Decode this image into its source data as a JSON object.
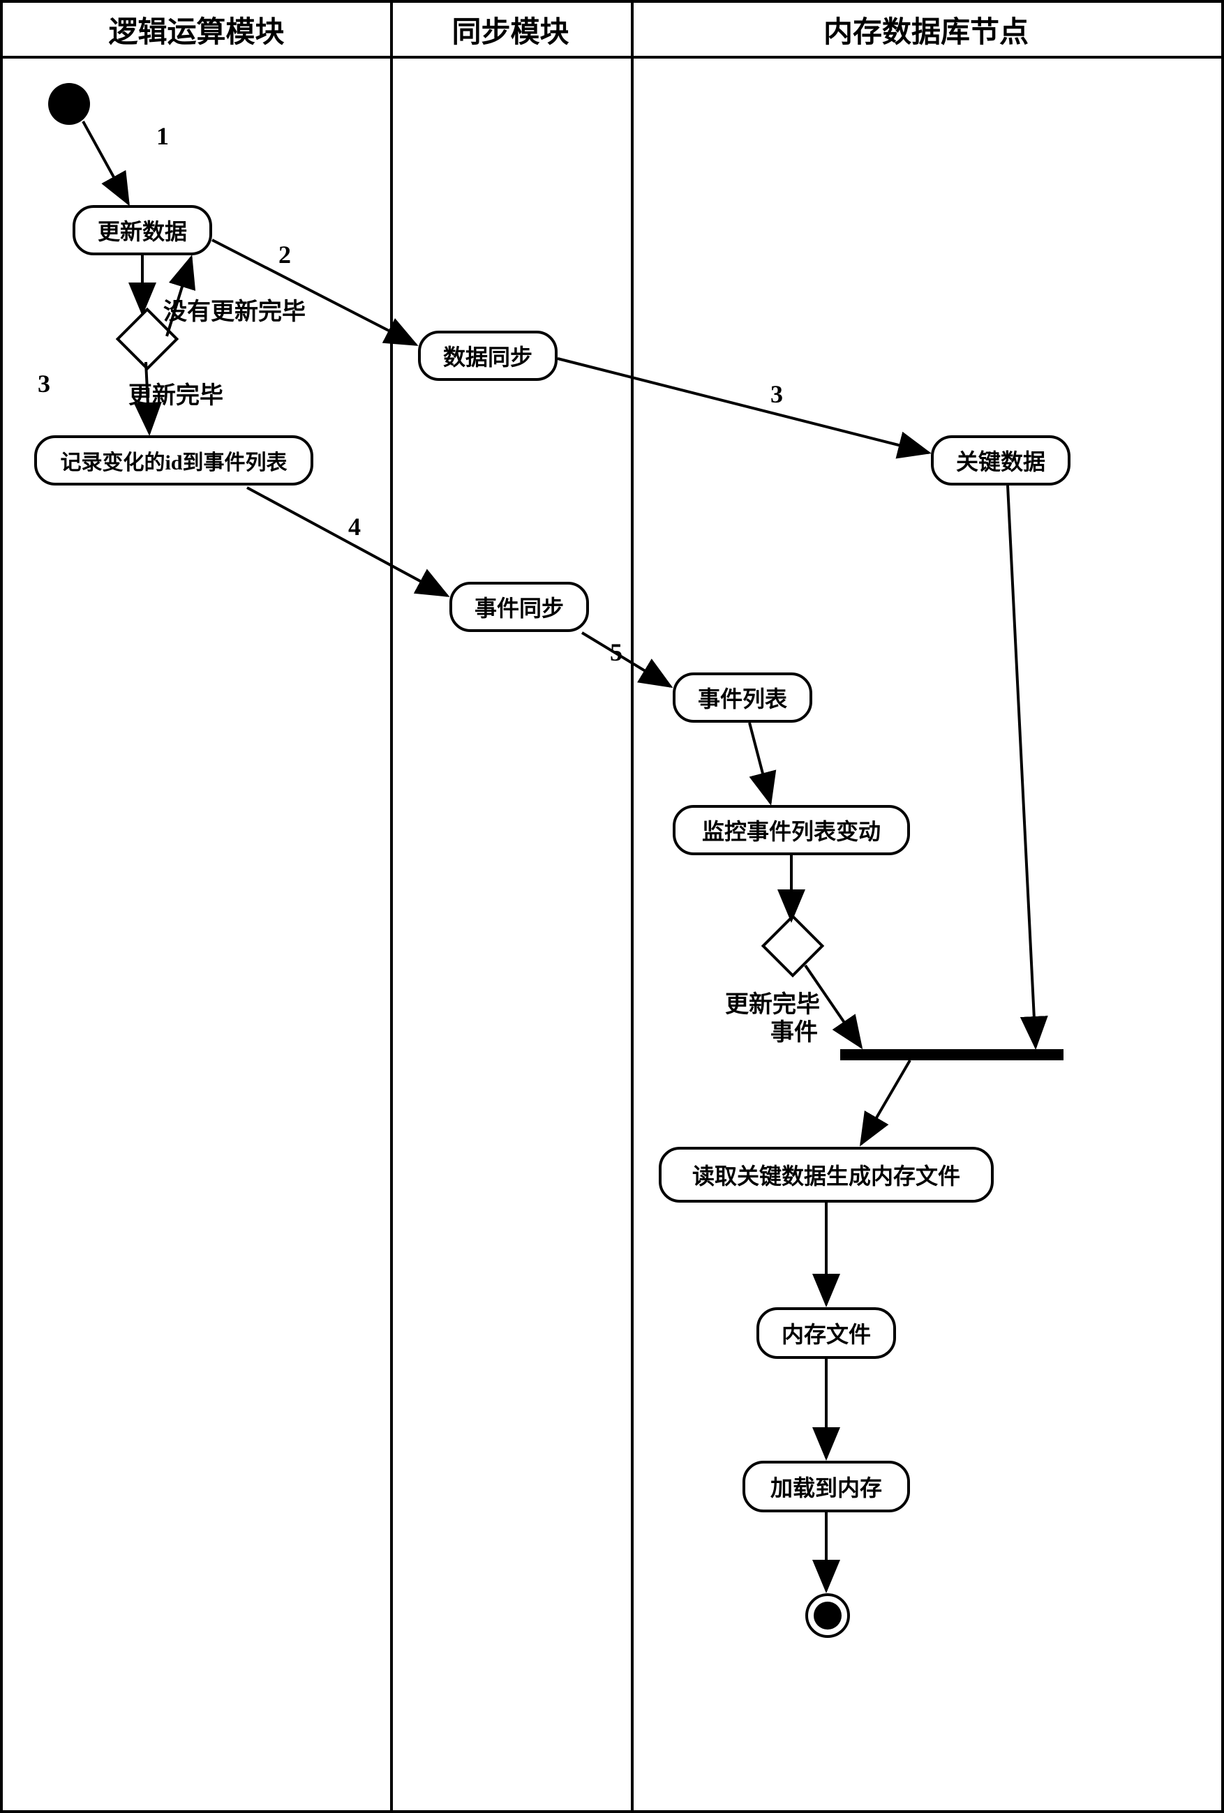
{
  "lanes": {
    "logic": "逻辑运算模块",
    "sync": "同步模块",
    "memdb": "内存数据库节点"
  },
  "activities": {
    "updateData": "更新数据",
    "recordChange": "记录变化的id到事件列表",
    "dataSync": "数据同步",
    "eventSync": "事件同步",
    "keyData": "关键数据",
    "eventList": "事件列表",
    "monitorEvent": "监控事件列表变动",
    "readKeyData": "读取关键数据生成内存文件",
    "memFile": "内存文件",
    "loadMem": "加载到内存"
  },
  "guards": {
    "notComplete": "没有更新完毕",
    "complete": "更新完毕",
    "completeEvent": "更新完毕",
    "eventLabel": "事件"
  },
  "edgeLabels": {
    "e1": "1",
    "e2": "2",
    "e3a": "3",
    "e3b": "3",
    "e4": "4",
    "e5": "5"
  }
}
